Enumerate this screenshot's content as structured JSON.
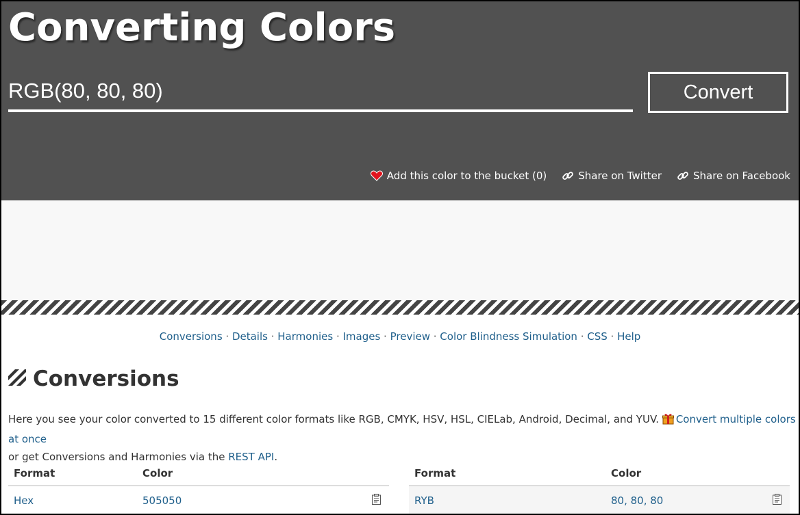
{
  "header": {
    "title": "Converting Colors",
    "input_value": "RGB(80, 80, 80)",
    "convert_label": "Convert",
    "actions": {
      "bucket": "Add this color to the bucket (0)",
      "twitter": "Share on Twitter",
      "facebook": "Share on Facebook"
    }
  },
  "nav": {
    "items": [
      "Conversions",
      "Details",
      "Harmonies",
      "Images",
      "Preview",
      "Color Blindness Simulation",
      "CSS",
      "Help"
    ],
    "separator": " · "
  },
  "section": {
    "title": "Conversions",
    "intro_text": "Here you see your color converted to 15 different color formats like RGB, CMYK, HSV, HSL, CIELab, Android, Decimal, and YUV.",
    "multi_link": "Convert multiple colors at once",
    "intro_text2": "or get Conversions and Harmonies via the",
    "api_link": "REST API",
    "intro_end": "."
  },
  "tables": {
    "left": {
      "headers": [
        "Format",
        "Color"
      ],
      "rows": [
        {
          "format": "Hex",
          "color": "505050"
        }
      ]
    },
    "right": {
      "headers": [
        "Format",
        "Color"
      ],
      "rows": [
        {
          "format": "RYB",
          "color": "80, 80, 80"
        }
      ]
    }
  },
  "colors": {
    "header_bg": "#515151",
    "link": "#1f5f8b",
    "heart": "#e0141e",
    "gift": "#f0a020"
  },
  "icons": [
    "heart-icon",
    "link-icon",
    "stripes-icon",
    "gift-icon",
    "clipboard-icon"
  ]
}
